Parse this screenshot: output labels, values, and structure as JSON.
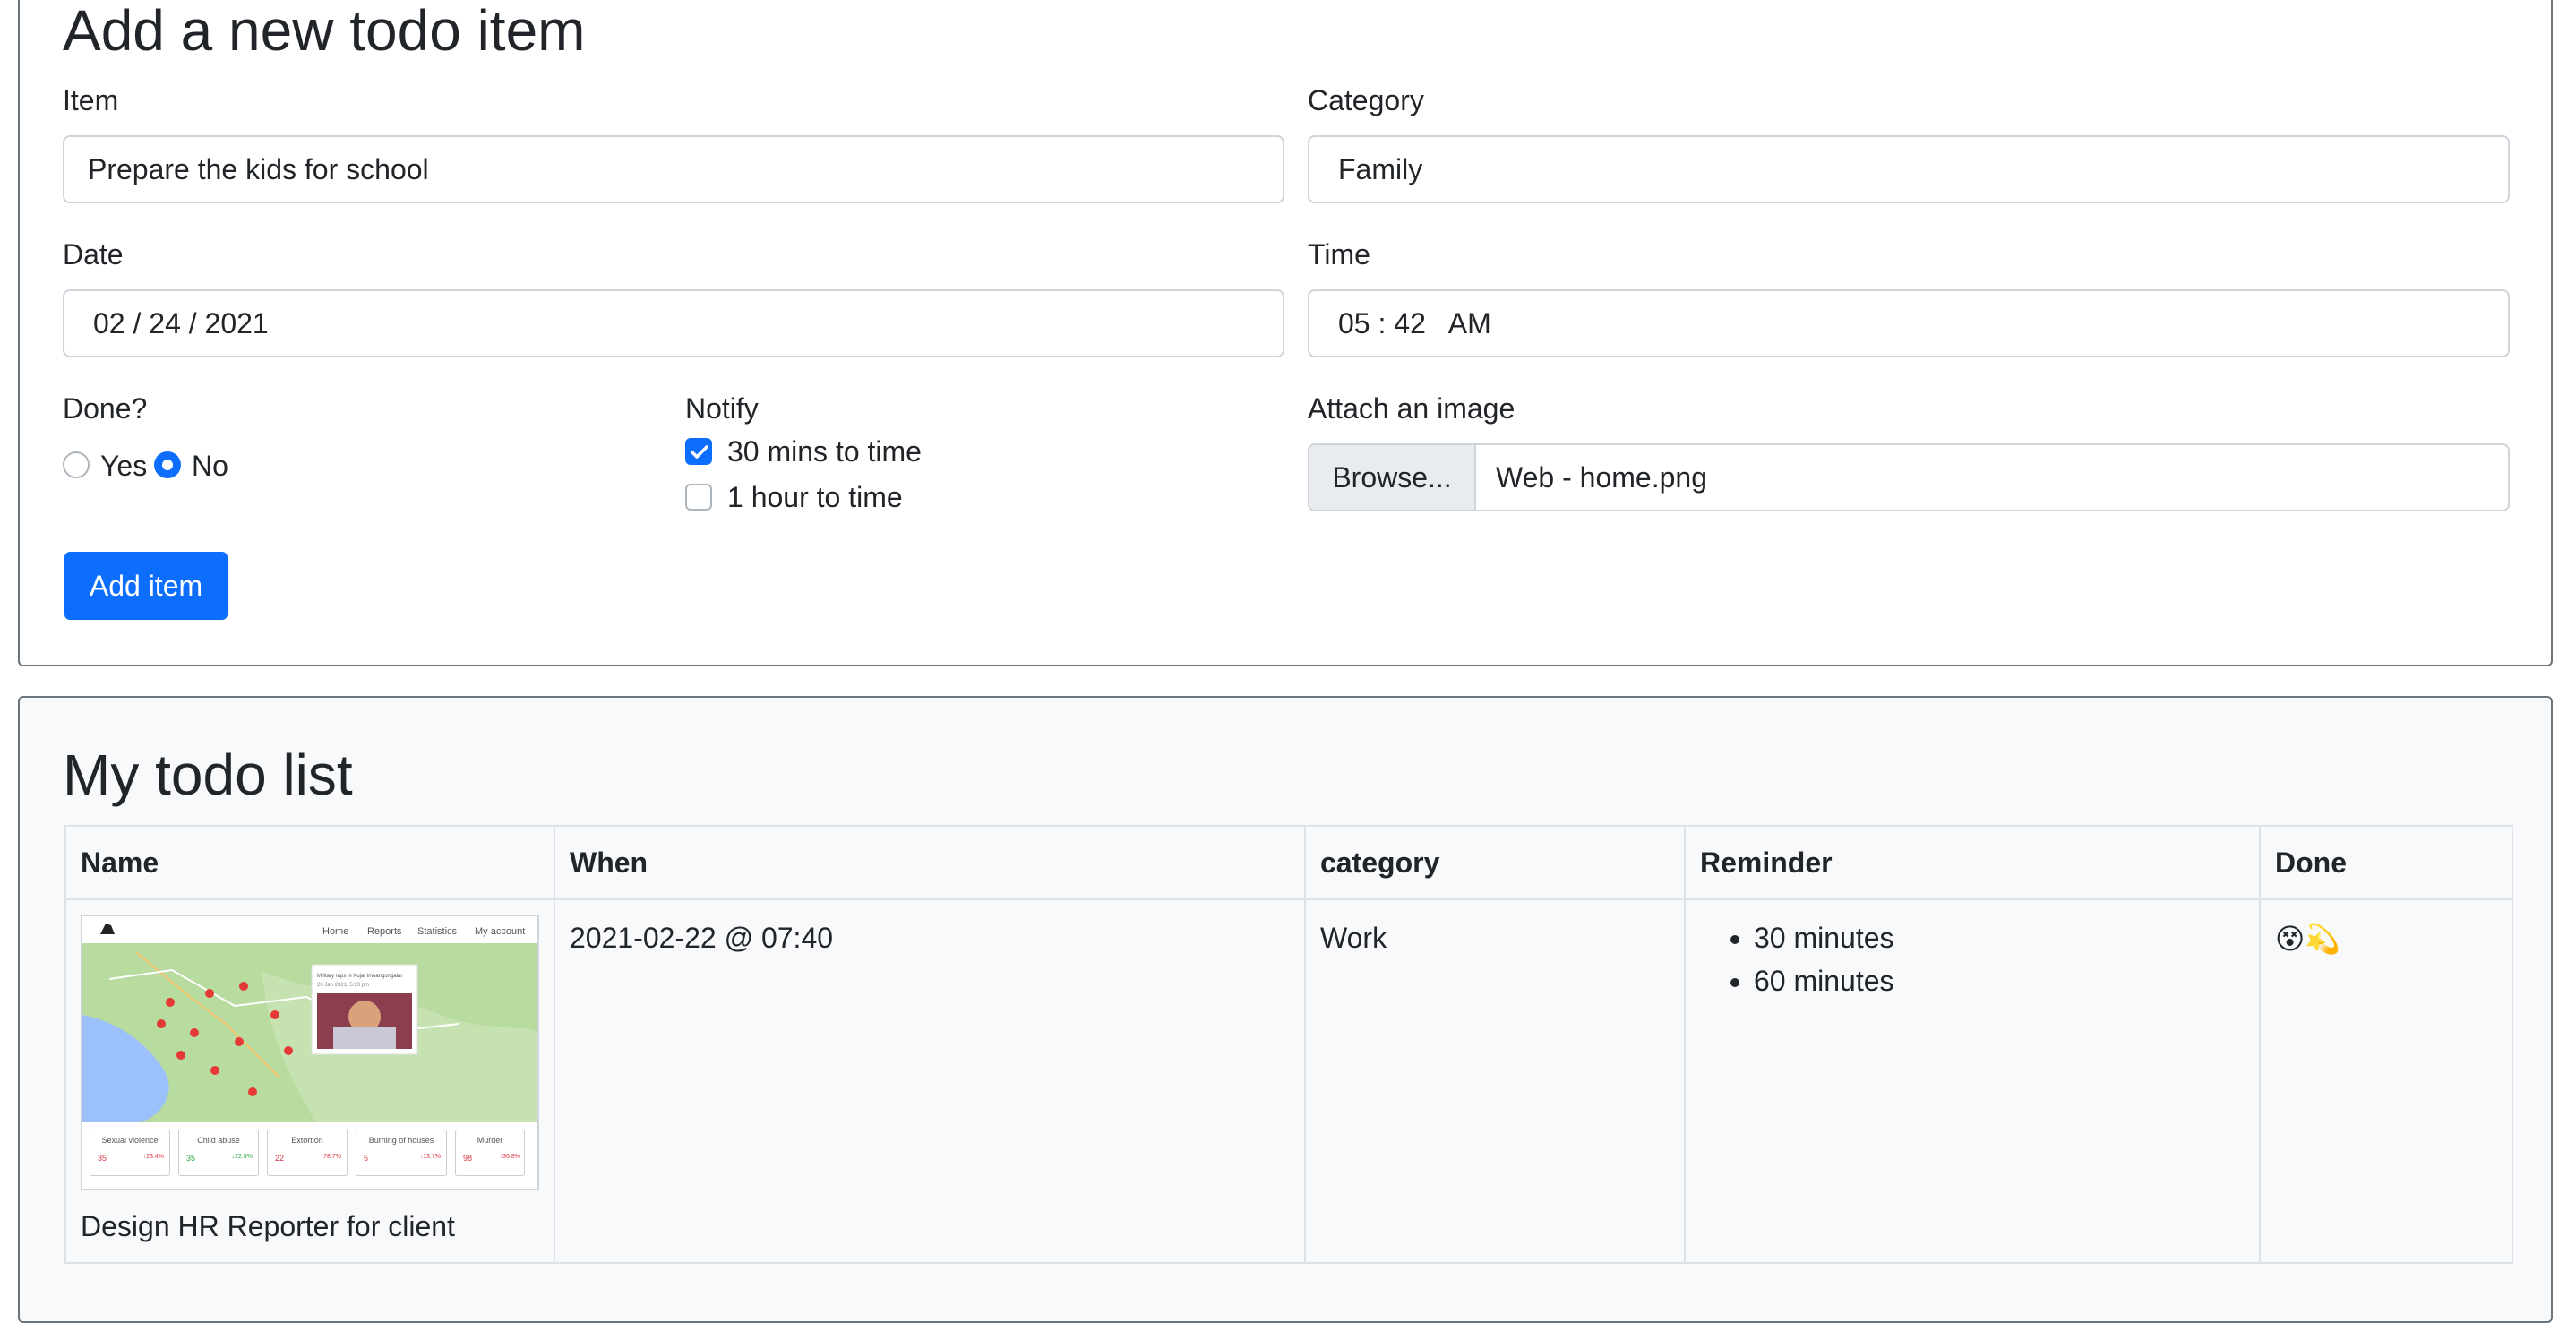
{
  "form": {
    "title": "Add a new todo item",
    "item_label": "Item",
    "item_value": "Prepare the kids for school",
    "category_label": "Category",
    "category_value": "Family",
    "date_label": "Date",
    "date_value": "02 / 24 / 2021",
    "time_label": "Time",
    "time_value": "05 : 42   AM",
    "done_label": "Done?",
    "done_options": [
      {
        "label": "Yes",
        "checked": false
      },
      {
        "label": "No",
        "checked": true
      }
    ],
    "notify_label": "Notify",
    "notify_options": [
      {
        "label": "30 mins to time",
        "checked": true
      },
      {
        "label": "1 hour to time",
        "checked": false
      }
    ],
    "attach_label": "Attach an image",
    "browse_label": "Browse...",
    "file_name": "Web - home.png",
    "submit_label": "Add item"
  },
  "list": {
    "title": "My todo list",
    "columns": [
      "Name",
      "When",
      "category",
      "Reminder",
      "Done"
    ],
    "rows": [
      {
        "name": "Design HR Reporter for client",
        "when": "2021-02-22 @ 07:40",
        "category": "Work",
        "reminders": [
          "30 minutes",
          "60 minutes"
        ],
        "done": "😵💫"
      }
    ]
  },
  "thumbnail": {
    "nav": [
      "Home",
      "Reports",
      "Statistics",
      "My account"
    ],
    "popup_text": "Military raps in Kujai Imuangongalar",
    "popup_date": "20 Jan 2021, 5:23 pm",
    "stats": [
      {
        "label": "Sexual violence",
        "value": "35",
        "change": "↑23.4%",
        "color": "#dc3545"
      },
      {
        "label": "Child abuse",
        "value": "35",
        "change": "↓22.8%",
        "color": "#28a745"
      },
      {
        "label": "Extortion",
        "value": "22",
        "change": "↑78.7%",
        "color": "#dc3545"
      },
      {
        "label": "Burning of houses",
        "value": "5",
        "change": "↑13.7%",
        "color": "#dc3545"
      },
      {
        "label": "Murder",
        "value": "98",
        "change": "↑36.8%",
        "color": "#dc3545"
      }
    ]
  },
  "colors": {
    "primary": "#0d6efd",
    "border": "#ced4da",
    "muted_bg": "#f8f9fa"
  }
}
